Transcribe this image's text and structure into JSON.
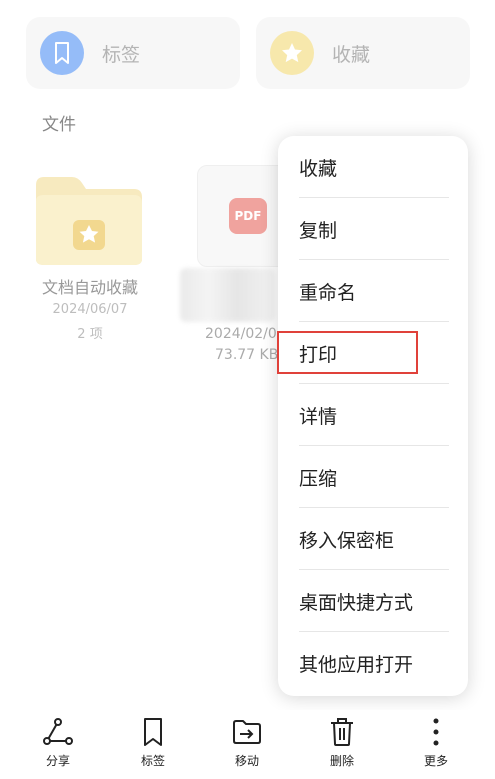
{
  "quick_access": {
    "tags_label": "标签",
    "favorites_label": "收藏"
  },
  "section": {
    "title": "文件"
  },
  "folder": {
    "name": "文档自动收藏",
    "date": "2024/06/07",
    "count": "2 项"
  },
  "file": {
    "badge": "PDF",
    "date": "2024/02/0",
    "size": "73.77 KB"
  },
  "context_menu": {
    "items": [
      "收藏",
      "复制",
      "重命名",
      "打印",
      "详情",
      "压缩",
      "移入保密柜",
      "桌面快捷方式",
      "其他应用打开"
    ],
    "highlighted": "打印"
  },
  "bottom_bar": {
    "share": "分享",
    "tag": "标签",
    "move": "移动",
    "delete": "删除",
    "more": "更多"
  },
  "colors": {
    "tag_circle": "#3f86f3",
    "favorite_circle": "#f2d66a",
    "pdf_badge": "#e4584f",
    "highlight_border": "#e0413a"
  }
}
